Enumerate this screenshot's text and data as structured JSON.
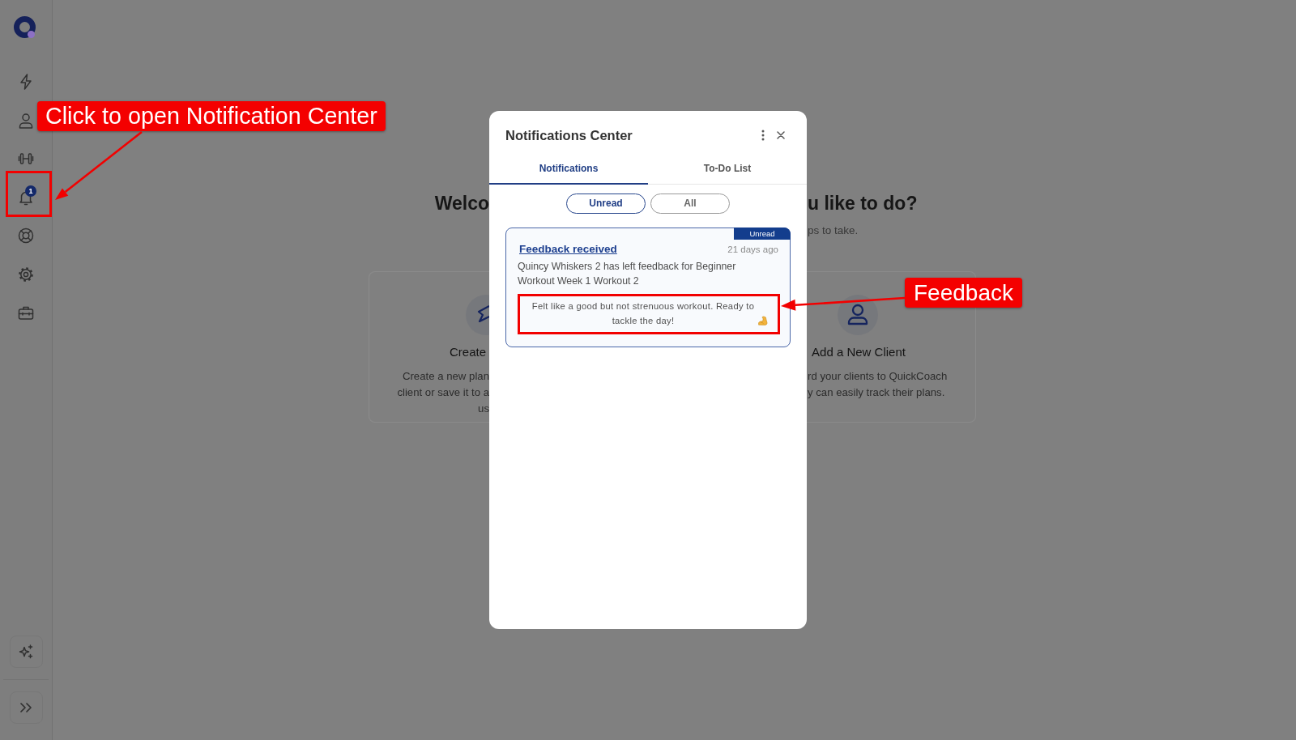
{
  "sidebar": {
    "notification_badge": "1"
  },
  "page": {
    "heading_left": "Welco",
    "heading_right": "u like to do?",
    "subtitle_right": "ps to take.",
    "left_card": {
      "title": "Create",
      "description_lines": [
        "Create a new plan",
        "client or save it to a",
        "us"
      ]
    },
    "right_card": {
      "title": "Add a New Client",
      "description_lines": [
        "rd your clients to QuickCoach",
        "y can easily track their plans."
      ]
    }
  },
  "notifications_center": {
    "title": "Notifications Center",
    "tabs": [
      {
        "label": "Notifications",
        "selected": true
      },
      {
        "label": "To-Do List",
        "selected": false
      }
    ],
    "filters": [
      {
        "label": "Unread",
        "selected": true
      },
      {
        "label": "All",
        "selected": false
      }
    ],
    "notifications": [
      {
        "unread": true,
        "tag": "Unread",
        "title": "Feedback received",
        "time": "21 days ago",
        "message": "Quincy Whiskers 2 has left feedback for Beginner Workout Week 1 Workout 2",
        "feedback": "Felt like a good but not strenuous workout. Ready to tackle the day!"
      }
    ]
  },
  "annotations": [
    {
      "text": "Click to open Notification Center"
    },
    {
      "text": "Feedback"
    }
  ]
}
